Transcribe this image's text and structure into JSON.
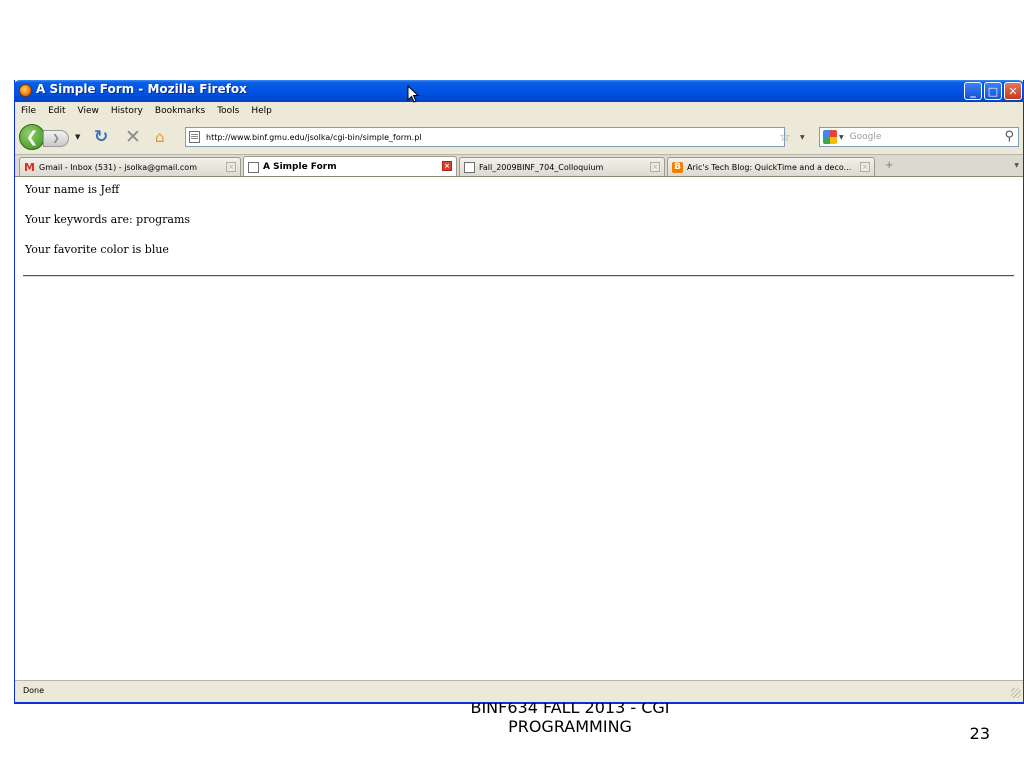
{
  "window": {
    "title": "A Simple Form - Mozilla Firefox",
    "buttons": {
      "minimize": "_",
      "maximize": "□",
      "close": "✕"
    }
  },
  "menu": {
    "items": [
      {
        "label": "File"
      },
      {
        "label": "Edit"
      },
      {
        "label": "View"
      },
      {
        "label": "History"
      },
      {
        "label": "Bookmarks"
      },
      {
        "label": "Tools"
      },
      {
        "label": "Help"
      }
    ]
  },
  "navbar": {
    "back_icon": "back-arrow-icon",
    "url": "http://www.binf.gmu.edu/jsolka/cgi-bin/simple_form.pl",
    "search_placeholder": "Google"
  },
  "tabs": [
    {
      "label": "Gmail - Inbox (531) - jsolka@gmail.com",
      "icon": "gmail-icon",
      "active": false
    },
    {
      "label": "A Simple Form",
      "icon": "page-icon",
      "active": true
    },
    {
      "label": "Fall_2009BINF_704_Colloquium",
      "icon": "page-icon",
      "active": false
    },
    {
      "label": "Aric's Tech Blog: QuickTime and a deco...",
      "icon": "blogger-icon",
      "active": false
    }
  ],
  "content": {
    "line1": "Your name is Jeff",
    "line2": "Your keywords are: programs",
    "line3": "Your favorite color is blue"
  },
  "status": {
    "text": "Done"
  },
  "slide": {
    "footer_line1": "BINF634 FALL 2013 - CGI",
    "footer_line2": "PROGRAMMING",
    "page_number": "23"
  }
}
